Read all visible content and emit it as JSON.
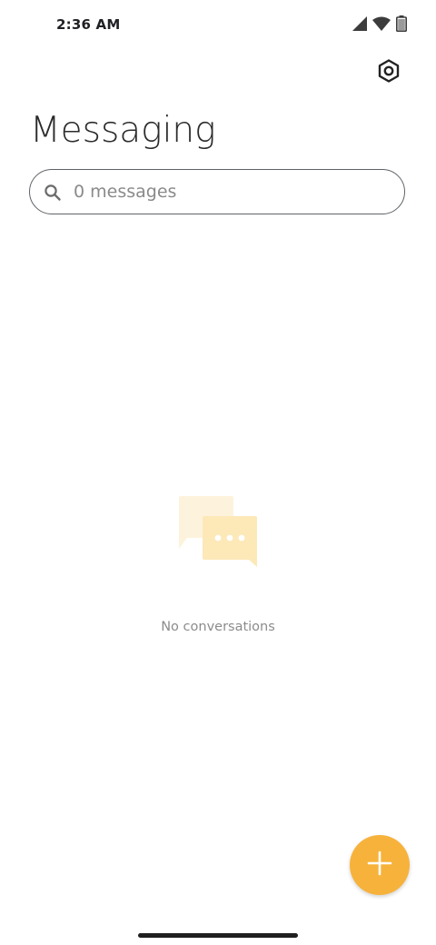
{
  "status_bar": {
    "time": "2:36 AM",
    "icons": [
      "cellular-signal-icon",
      "wifi-icon",
      "battery-icon"
    ]
  },
  "toolbar": {
    "settings_icon": "settings-icon"
  },
  "header": {
    "title": "Messaging"
  },
  "search": {
    "placeholder": "0 messages",
    "value": "",
    "icon": "search-icon"
  },
  "empty_state": {
    "illustration": "chat-bubbles-icon",
    "message": "No conversations"
  },
  "fab": {
    "icon": "plus-icon",
    "color": "#f7b23b"
  },
  "colors": {
    "accent": "#f7b23b",
    "illustration_light": "#fdf1d6",
    "illustration_mid": "#fde8b8"
  }
}
